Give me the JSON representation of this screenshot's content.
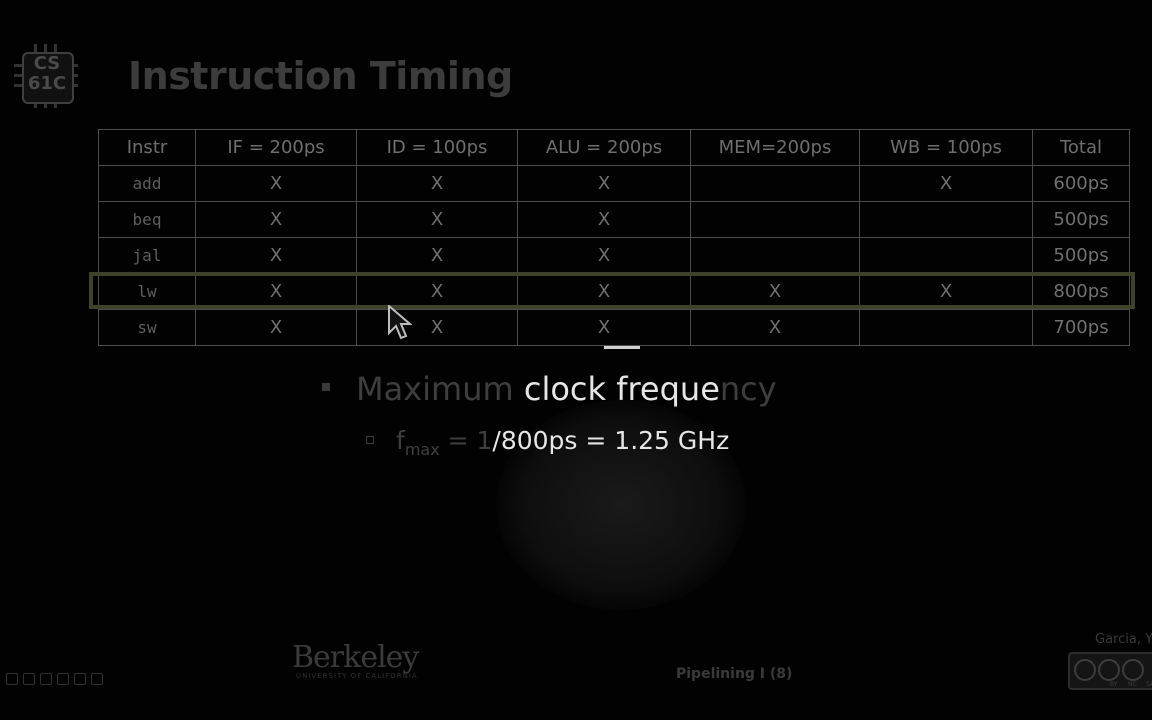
{
  "logo": {
    "line1": "CS",
    "line2": "61C"
  },
  "title": "Instruction Timing",
  "table": {
    "headers": [
      "Instr",
      "IF = 200ps",
      "ID = 100ps",
      "ALU = 200ps",
      "MEM=200ps",
      "WB = 100ps",
      "Total"
    ],
    "rows": [
      {
        "instr": "add",
        "cells": [
          "X",
          "X",
          "X",
          "",
          "X"
        ],
        "total": "600ps"
      },
      {
        "instr": "beq",
        "cells": [
          "X",
          "X",
          "X",
          "",
          ""
        ],
        "total": "500ps"
      },
      {
        "instr": "jal",
        "cells": [
          "X",
          "X",
          "X",
          "",
          ""
        ],
        "total": "500ps"
      },
      {
        "instr": "lw",
        "cells": [
          "X",
          "X",
          "X",
          "X",
          "X"
        ],
        "total": "800ps"
      },
      {
        "instr": "sw",
        "cells": [
          "X",
          "X",
          "X",
          "X",
          ""
        ],
        "total": "700ps"
      }
    ],
    "highlighted_row": "lw"
  },
  "bullets": {
    "main_dim": "Maximum ",
    "main_bright": "clock freque",
    "main_dim2": "ncy",
    "sub_prefix": "f",
    "sub_subscript": "max",
    "sub_dim": " = 1",
    "sub_bright": "/800ps = 1.25 GHz"
  },
  "footer": {
    "university": "Berkeley",
    "university_sub": "UNIVERSITY OF CALIFORNIA",
    "section": "Pipelining I (8)",
    "author": "Garcia, Yo",
    "license_labels": [
      "BY",
      "NC",
      "SA"
    ]
  },
  "icons": [
    "cursor-pointer-icon",
    "pen-icon",
    "slide-control-icons",
    "creative-commons-icon"
  ]
}
